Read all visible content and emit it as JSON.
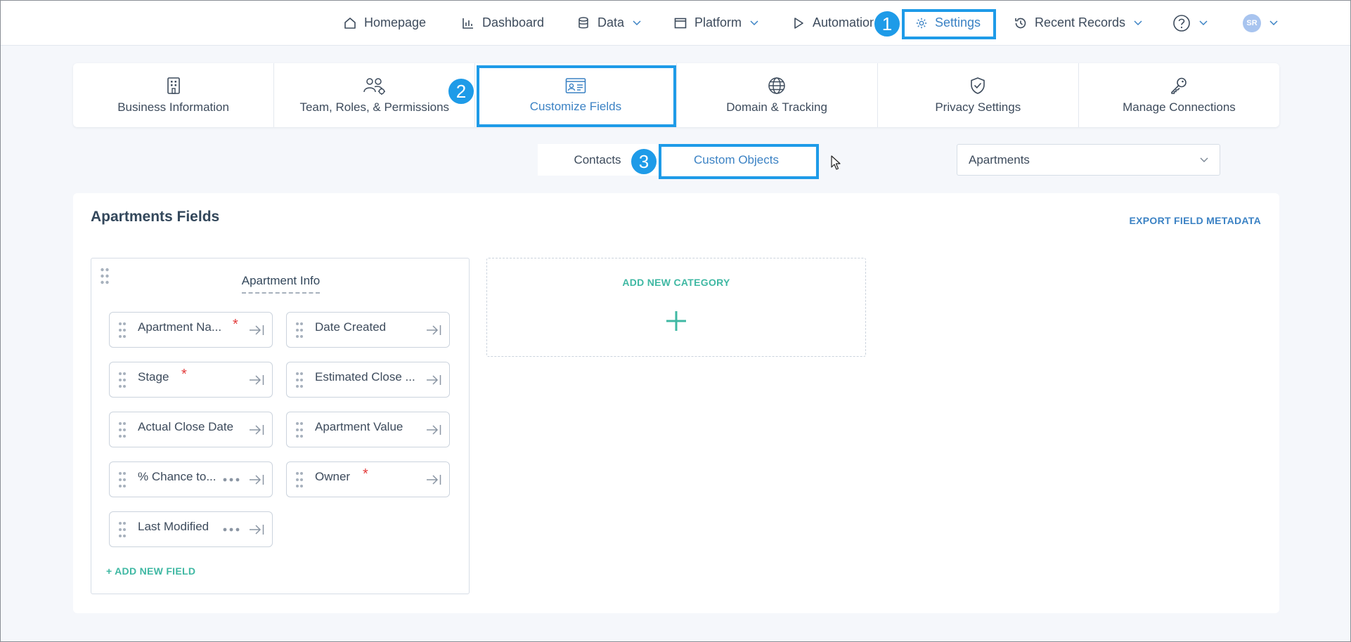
{
  "topnav": {
    "items": [
      {
        "label": "Homepage",
        "icon": "home-icon"
      },
      {
        "label": "Dashboard",
        "icon": "bar-chart-icon"
      },
      {
        "label": "Data",
        "icon": "database-icon"
      },
      {
        "label": "Platform",
        "icon": "window-icon"
      },
      {
        "label": "Automation",
        "icon": "play-icon"
      },
      {
        "label": "Settings",
        "icon": "gear-icon"
      },
      {
        "label": "Recent Records",
        "icon": "history-icon"
      }
    ],
    "avatar_initials": "SR"
  },
  "annotations": {
    "step1": "1",
    "step2": "2",
    "step3": "3"
  },
  "settings_tabs": [
    {
      "label": "Business Information",
      "icon": "building-icon"
    },
    {
      "label": "Team, Roles, & Permissions",
      "icon": "team-icon"
    },
    {
      "label": "Customize Fields",
      "icon": "id-card-icon"
    },
    {
      "label": "Domain & Tracking",
      "icon": "globe-icon"
    },
    {
      "label": "Privacy Settings",
      "icon": "shield-check-icon"
    },
    {
      "label": "Manage Connections",
      "icon": "key-icon"
    }
  ],
  "subtoggle": {
    "contacts": "Contacts",
    "custom_objects": "Custom Objects"
  },
  "object_select": {
    "value": "Apartments"
  },
  "card": {
    "title": "Apartments Fields",
    "export_label": "EXPORT FIELD METADATA",
    "category": {
      "name": "Apartment Info",
      "fields": [
        {
          "name": "Apartment Na...",
          "required": "*"
        },
        {
          "name": "Date Created"
        },
        {
          "name": "Stage",
          "required": "*"
        },
        {
          "name": "Estimated Close ..."
        },
        {
          "name": "Actual Close Date"
        },
        {
          "name": "Apartment Value"
        },
        {
          "name": "% Chance to..."
        },
        {
          "name": "Owner",
          "required": "*"
        },
        {
          "name": "Last Modified"
        }
      ],
      "add_field_label": "+ ADD NEW FIELD"
    },
    "add_category_label": "ADD NEW CATEGORY"
  },
  "colors": {
    "accent": "#3b82c4",
    "highlight": "#1e9be8",
    "teal": "#3fb8a3",
    "required": "#e23b3b"
  }
}
